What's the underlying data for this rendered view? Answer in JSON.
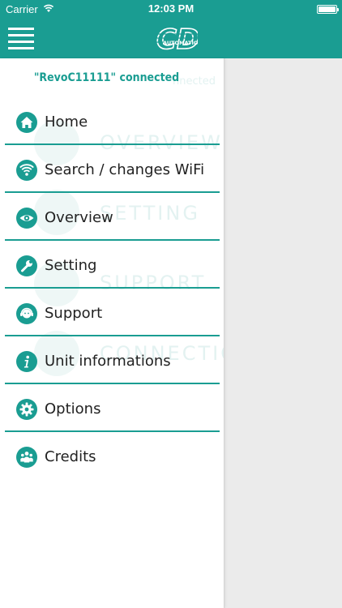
{
  "status_bar": {
    "carrier": "Carrier",
    "time": "12:03 PM"
  },
  "header": {
    "logo_text": "CD",
    "logo_subtext": "AUTOMATION"
  },
  "connection": {
    "text": "\"RevoC11111\" connected",
    "ghost_text": "nnected"
  },
  "background_labels": [
    "OVERVIEW",
    "SETTING",
    "SUPPORT",
    "CONNECTION"
  ],
  "menu": {
    "items": [
      {
        "label": "Home",
        "icon": "home-icon"
      },
      {
        "label": "Search / changes WiFi",
        "icon": "wifi-icon"
      },
      {
        "label": "Overview",
        "icon": "eye-icon"
      },
      {
        "label": "Setting",
        "icon": "wrench-icon"
      },
      {
        "label": "Support",
        "icon": "support-icon"
      },
      {
        "label": "Unit informations",
        "icon": "info-icon"
      },
      {
        "label": "Options",
        "icon": "gear-icon"
      },
      {
        "label": "Credits",
        "icon": "people-icon"
      }
    ]
  },
  "colors": {
    "accent": "#1a9d92",
    "text": "#222222",
    "drawer_bg": "#ffffff",
    "content_bg": "#ebebeb"
  }
}
